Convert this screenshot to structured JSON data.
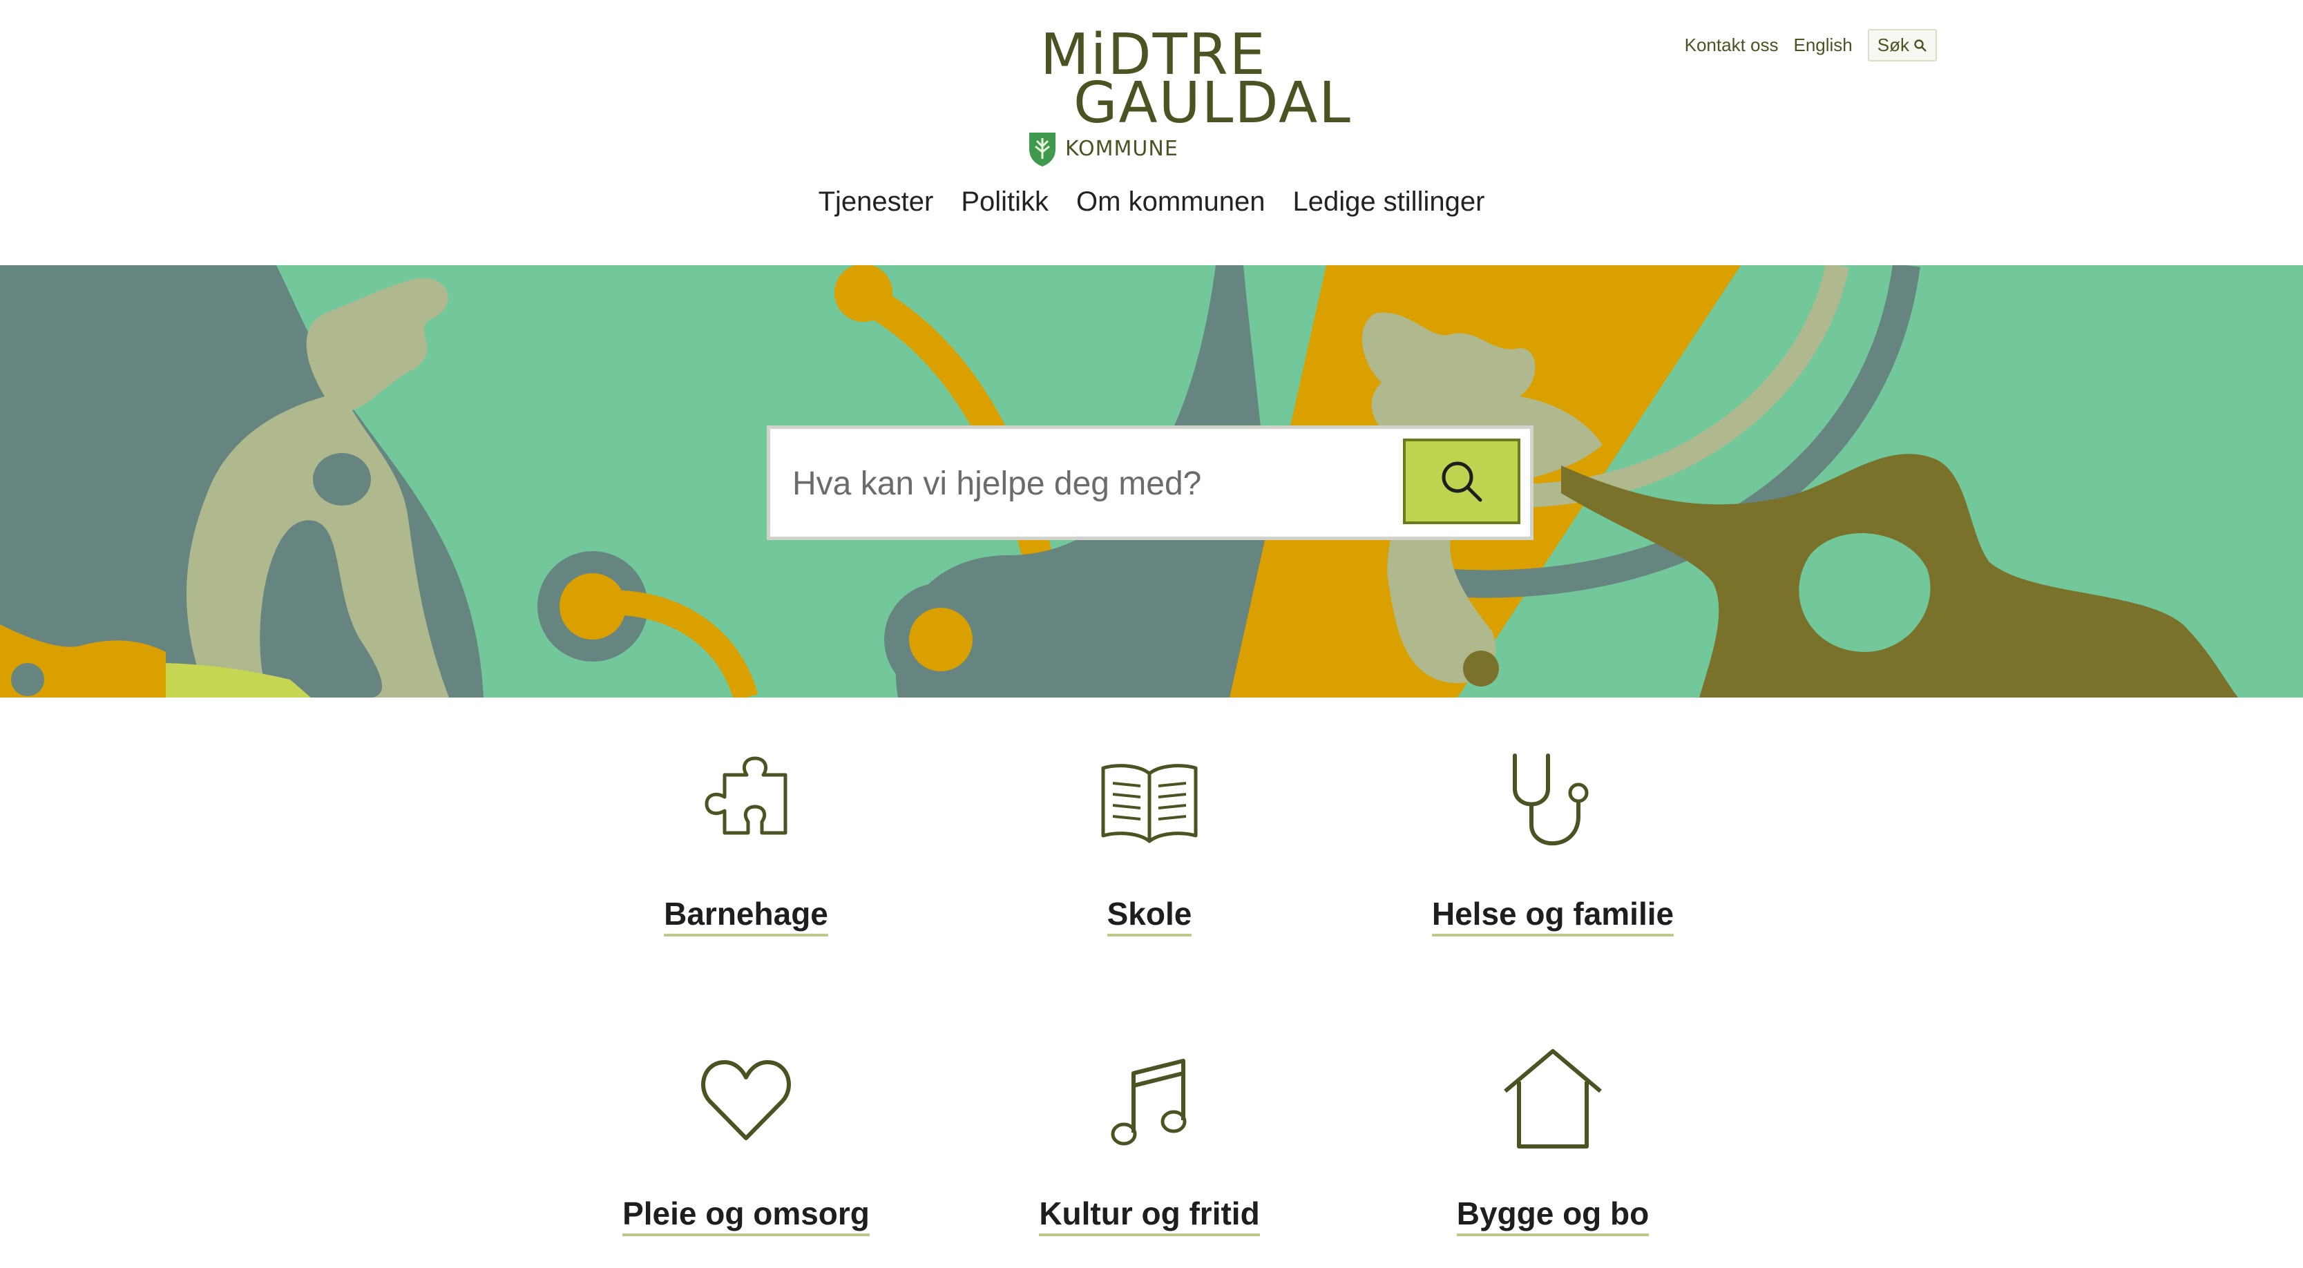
{
  "header": {
    "logo": {
      "line1": "MiDTRE",
      "line2": "GAULDAL",
      "sub": "KOMMUNE",
      "color": "#4a5322",
      "shield_color": "#3f9a4e"
    },
    "utility_links": {
      "contact": "Kontakt oss",
      "english": "English",
      "search": "Søk",
      "search_icon": "search-icon"
    },
    "nav": {
      "services": "Tjenester",
      "politics": "Politikk",
      "about": "Om kommunen",
      "jobs": "Ledige stillinger"
    }
  },
  "hero": {
    "background_color": "#72c79b",
    "search": {
      "placeholder": "Hva kan vi hjelpe deg med?",
      "value": "",
      "button_icon": "search-icon",
      "button_color": "#bfd350"
    }
  },
  "categories": [
    {
      "label": "Barnehage",
      "icon": "puzzle-icon"
    },
    {
      "label": "Skole",
      "icon": "book-icon"
    },
    {
      "label": "Helse og familie",
      "icon": "stethoscope-icon"
    },
    {
      "label": "Pleie og omsorg",
      "icon": "heart-icon"
    },
    {
      "label": "Kultur og fritid",
      "icon": "music-note-icon"
    },
    {
      "label": "Bygge og bo",
      "icon": "house-icon"
    }
  ],
  "colors": {
    "icon_stroke": "#4a5322",
    "underline": "#bcc98a",
    "gray_shape": "#668580",
    "beige_shape": "#b0b98e",
    "mustard_shape": "#d9a000",
    "olive_shape": "#7a722a",
    "lime_shape": "#c6d652"
  }
}
